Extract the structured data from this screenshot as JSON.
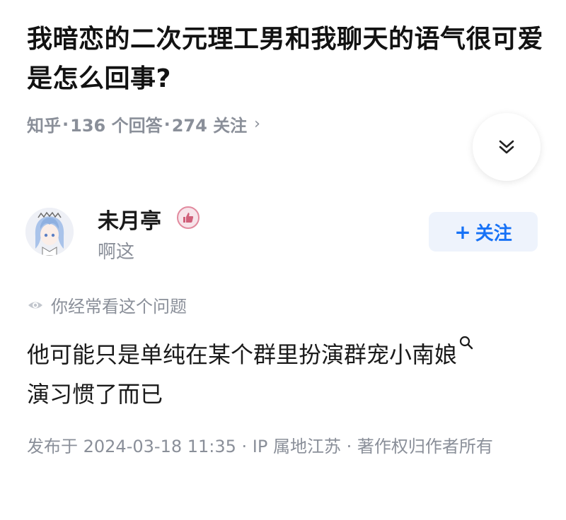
{
  "question": {
    "title": "我暗恋的二次元理工男和我聊天的语气很可爱是怎么回事?"
  },
  "meta": {
    "source": "知乎",
    "sep1": "·",
    "answers": "136 个回答",
    "sep2": "·",
    "followers": "274 关注",
    "chevron": "›"
  },
  "expand_icon": "chevron-double-down-icon",
  "author": {
    "name": "未月亭",
    "bio": "啊这",
    "avatar_icon": "anime-avatar-icon",
    "badge_icon": "thumbs-up-badge-icon"
  },
  "follow_button": {
    "plus": "+",
    "label": "关注"
  },
  "hint": {
    "text": "你经常看这个问题"
  },
  "answer": {
    "text_line1": "他可能只是单纯在某个群里扮演群宠小南娘",
    "text_line2": "演习惯了而已"
  },
  "footer": {
    "text": "发布于 2024-03-18 11:35 · IP 属地江苏 · 著作权归作者所有"
  },
  "colors": {
    "accent_blue": "#1772f6",
    "follow_bg": "#eef3fc",
    "meta_gray": "#8a8f99",
    "badge_pink": "#e28a9e"
  }
}
